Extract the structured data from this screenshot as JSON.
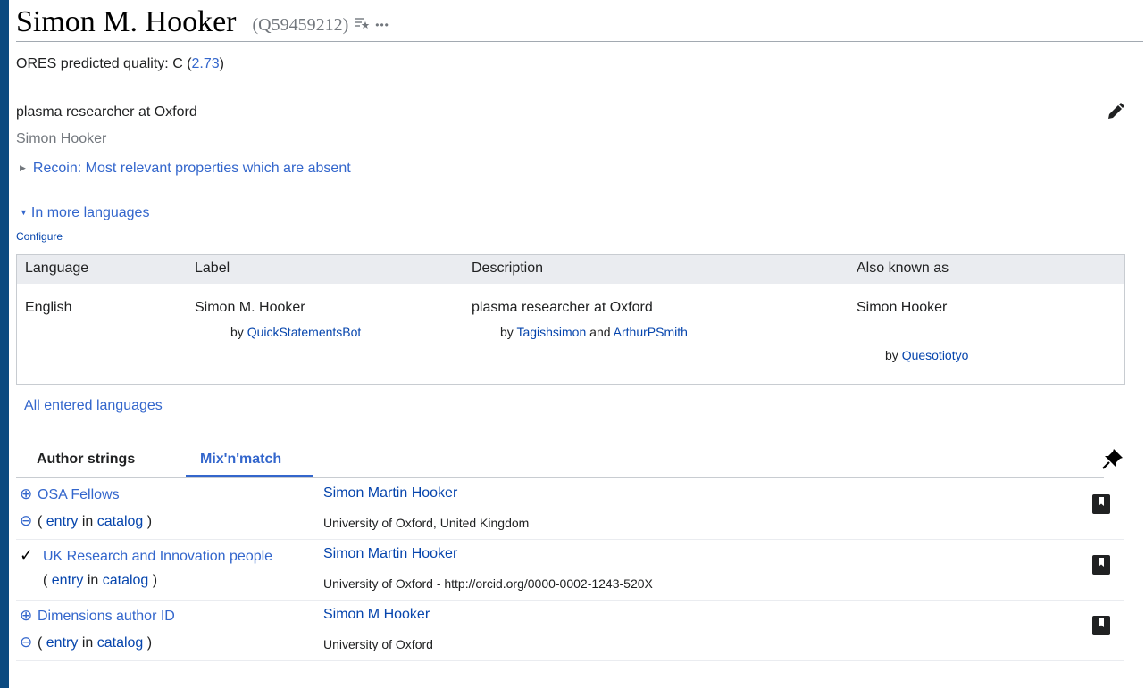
{
  "heading": {
    "title": "Simon M. Hooker",
    "qid": "(Q59459212)",
    "icon1": "list-star-icon",
    "icon2": "more-icon",
    "more": "•••"
  },
  "ores": {
    "prefix": "ORES predicted quality: C (",
    "score": "2.73",
    "suffix": ")"
  },
  "description": "plasma researcher at Oxford",
  "alias": "Simon Hooker",
  "recoin": "Recoin: Most relevant properties which are absent",
  "more_languages": "In more languages",
  "configure": "Configure",
  "lang_table": {
    "headers": [
      "Language",
      "Label",
      "Description",
      "Also known as"
    ],
    "row": {
      "language": "English",
      "label": "Simon M. Hooker",
      "label_by": "QuickStatementsBot",
      "description": "plasma researcher at Oxford",
      "desc_by1": "Tagishsimon",
      "desc_and": "and",
      "desc_by2": "ArthurPSmith",
      "aka": "Simon Hooker",
      "aka_by": "Quesotiotyo",
      "by_word": "by"
    }
  },
  "all_languages": "All entered languages",
  "tabs": {
    "author": "Author strings",
    "mix": "Mix'n'match"
  },
  "mixnmatch": [
    {
      "catalog": "OSA Fellows",
      "match": "Simon Martin Hooker",
      "detail": "University of Oxford, United Kingdom",
      "plus": "⊕",
      "minus": "⊖",
      "status": ""
    },
    {
      "catalog": "UK Research and Innovation people",
      "match": "Simon Martin Hooker",
      "detail": "University of Oxford - http://orcid.org/0000-0002-1243-520X",
      "plus": "",
      "minus": "",
      "status": "✓"
    },
    {
      "catalog": "Dimensions author ID",
      "match": "Simon M Hooker",
      "detail": "University of Oxford",
      "plus": "⊕",
      "minus": "⊖",
      "status": ""
    }
  ],
  "entry_parts": {
    "open": "(",
    "entry": "entry",
    "in": "in",
    "catalog": "catalog",
    "close": ")"
  }
}
